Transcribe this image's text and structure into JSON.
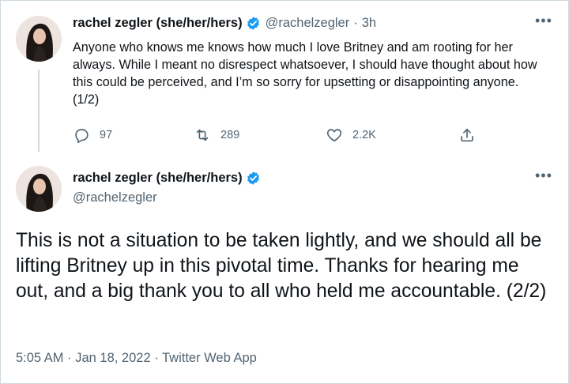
{
  "tweet1": {
    "display_name": "rachel zegler (she/her/hers)",
    "handle": "@rachelzegler",
    "separator": "·",
    "time": "3h",
    "more": "•••",
    "text": "Anyone who knows me knows how much I love Britney and am rooting for her always. While I meant no disrespect whatsoever, I should have thought about how this could be perceived, and I’m so sorry for upsetting or disappointing anyone. (1/2)",
    "replies": "97",
    "retweets": "289",
    "likes": "2.2K"
  },
  "tweet2": {
    "display_name": "rachel zegler (she/her/hers)",
    "handle": "@rachelzegler",
    "more": "•••",
    "text": "This is not a situation to be taken lightly, and we should all be lifting Britney up in this pivotal time. Thanks for hearing me out, and a big thank you to all who held me accountable. (2/2)",
    "timestamp": "5:05 AM · Jan 18, 2022 · Twitter Web App"
  },
  "colors": {
    "verified": "#1d9bf0",
    "secondary_text": "#536471",
    "border": "#cfd9de"
  },
  "icons": [
    "verified-badge-icon",
    "more-icon",
    "reply-icon",
    "retweet-icon",
    "like-icon",
    "share-icon"
  ]
}
